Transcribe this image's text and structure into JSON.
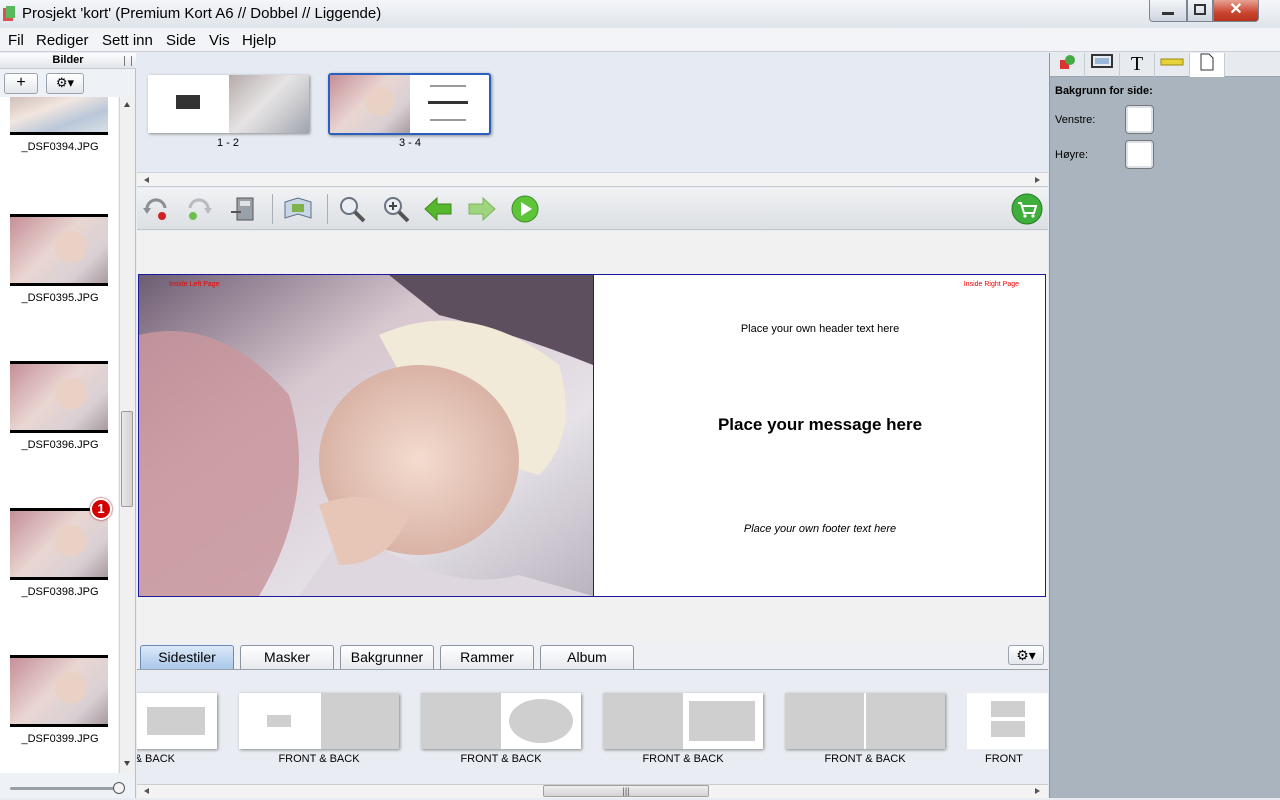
{
  "window": {
    "title": "Prosjekt 'kort' (Premium Kort A6 // Dobbel // Liggende)",
    "close_glyph": "✕"
  },
  "menu": [
    "Fil",
    "Rediger",
    "Sett inn",
    "Side",
    "Vis",
    "Hjelp"
  ],
  "left_panel": {
    "title": "Bilder",
    "add_glyph": "+",
    "settings_glyph": "⚙▾",
    "images": [
      {
        "name": "_DSF0394.JPG"
      },
      {
        "name": "_DSF0395.JPG"
      },
      {
        "name": "_DSF0396.JPG"
      },
      {
        "name": "_DSF0398.JPG",
        "badge": "1"
      },
      {
        "name": "_DSF0399.JPG"
      }
    ]
  },
  "pages": [
    {
      "label": "1 - 2"
    },
    {
      "label": "3 - 4",
      "selected": true
    }
  ],
  "toolbar": [
    "undo-icon",
    "redo-icon",
    "export-icon",
    "preview-icon",
    "zoom-out-icon",
    "zoom-in-icon",
    "previous-icon",
    "next-icon",
    "play-icon",
    "cart-icon"
  ],
  "spread": {
    "left_tag": "Inside Left Page",
    "right_tag": "Inside Right Page",
    "header_text": "Place your own header text here",
    "message_text": "Place your message here",
    "footer_text": "Place your own footer text here"
  },
  "tabs": {
    "items": [
      "Sidestiler",
      "Masker",
      "Bakgrunner",
      "Rammer",
      "Album"
    ],
    "active": "Sidestiler",
    "gear_glyph": "⚙▾"
  },
  "styles": [
    "& BACK",
    "FRONT & BACK",
    "FRONT & BACK",
    "FRONT & BACK",
    "FRONT & BACK",
    "FRONT"
  ],
  "right_panel": {
    "icons": [
      "shapes-icon",
      "frame-icon",
      "text-icon",
      "ruler-icon",
      "page-icon"
    ],
    "text_glyph": "T",
    "title": "Bakgrunn for side:",
    "left_label": "Venstre:",
    "right_label": "Høyre:"
  },
  "colors": {
    "selection": "#2b5fbf",
    "accent": "#1a1a9a",
    "badge": "#d40000"
  }
}
